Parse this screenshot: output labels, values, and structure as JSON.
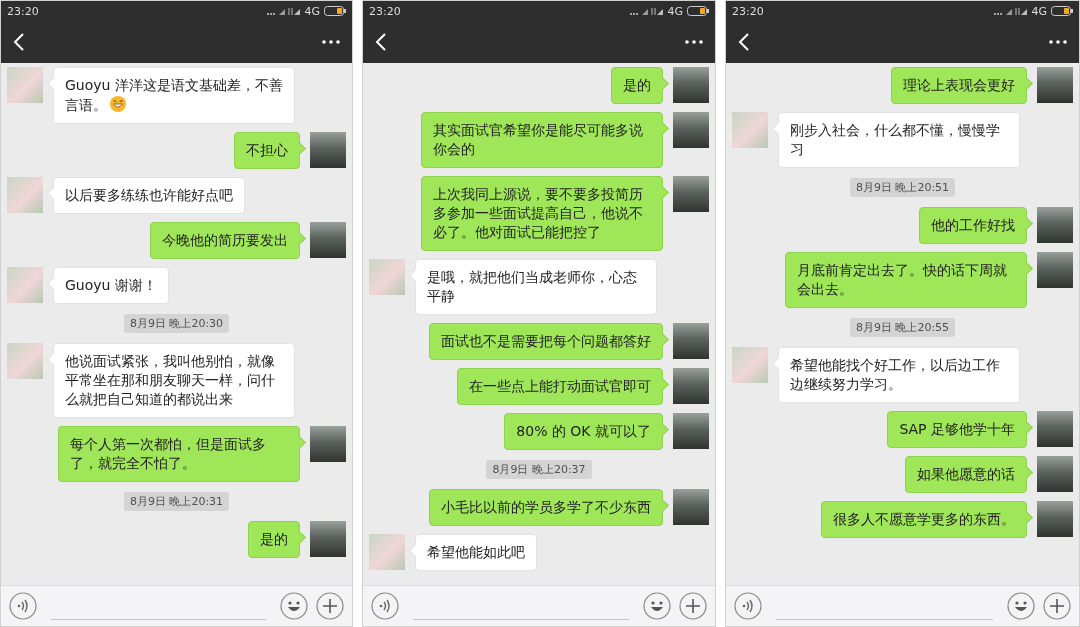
{
  "phones": [
    {
      "status": {
        "time": "23:20",
        "network": "4G"
      },
      "messages": [
        {
          "kind": "in",
          "text": "Guoyu 洋洋这是语文基础差，不善言语。",
          "emoji": true
        },
        {
          "kind": "out",
          "text": "不担心"
        },
        {
          "kind": "in",
          "text": "以后要多练练也许能好点吧"
        },
        {
          "kind": "out",
          "text": "今晚他的简历要发出"
        },
        {
          "kind": "in",
          "text": "Guoyu 谢谢！"
        },
        {
          "kind": "time",
          "text": "8月9日 晚上20:30"
        },
        {
          "kind": "in",
          "text": "他说面试紧张，我叫他别怕，就像平常坐在那和朋友聊天一样，问什么就把自己知道的都说出来"
        },
        {
          "kind": "out",
          "text": "每个人第一次都怕，但是面试多了，就完全不怕了。"
        },
        {
          "kind": "time",
          "text": "8月9日 晚上20:31"
        },
        {
          "kind": "out",
          "text": "是的"
        }
      ]
    },
    {
      "status": {
        "time": "23:20",
        "network": "4G"
      },
      "messages": [
        {
          "kind": "out",
          "text": "是的"
        },
        {
          "kind": "out",
          "text": "其实面试官希望你是能尽可能多说你会的"
        },
        {
          "kind": "out",
          "text": "上次我同上源说，要不要多投简历多参加一些面试提高自己，他说不必了。他对面试已能把控了"
        },
        {
          "kind": "in",
          "text": "是哦，就把他们当成老师你，心态平静"
        },
        {
          "kind": "out",
          "text": "面试也不是需要把每个问题都答好"
        },
        {
          "kind": "out",
          "text": "在一些点上能打动面试官即可"
        },
        {
          "kind": "out",
          "text": "80% 的 OK 就可以了"
        },
        {
          "kind": "time",
          "text": "8月9日 晚上20:37"
        },
        {
          "kind": "out",
          "text": "小毛比以前的学员多学了不少东西"
        },
        {
          "kind": "in",
          "text": "希望他能如此吧"
        }
      ]
    },
    {
      "status": {
        "time": "23:20",
        "network": "4G"
      },
      "messages": [
        {
          "kind": "out",
          "text": "理论上表现会更好"
        },
        {
          "kind": "in",
          "text": "刚步入社会，什么都不懂，慢慢学习"
        },
        {
          "kind": "time",
          "text": "8月9日 晚上20:51"
        },
        {
          "kind": "out",
          "text": "他的工作好找"
        },
        {
          "kind": "out",
          "text": "月底前肯定出去了。快的话下周就会出去。"
        },
        {
          "kind": "time",
          "text": "8月9日 晚上20:55"
        },
        {
          "kind": "in",
          "text": "希望他能找个好工作，以后边工作边继续努力学习。"
        },
        {
          "kind": "out",
          "text": "SAP 足够他学十年"
        },
        {
          "kind": "out",
          "text": "如果他愿意的话"
        },
        {
          "kind": "out",
          "text": "很多人不愿意学更多的东西。"
        }
      ]
    }
  ]
}
